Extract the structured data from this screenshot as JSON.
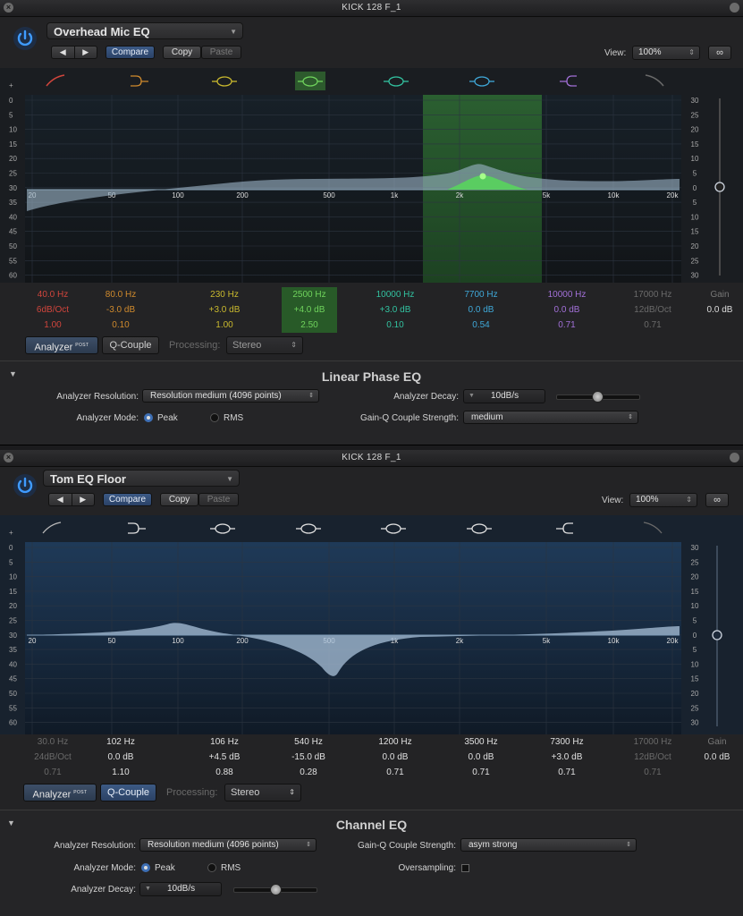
{
  "win1": {
    "title": "KICK 128 F_1",
    "preset": "Overhead Mic EQ",
    "compare": "Compare",
    "copy": "Copy",
    "paste": "Paste",
    "view_label": "View:",
    "view_value": "100%",
    "db_left": [
      "+",
      "0",
      "5",
      "10",
      "15",
      "20",
      "25",
      "30",
      "35",
      "40",
      "45",
      "50",
      "55",
      "60"
    ],
    "db_right": [
      "30",
      "25",
      "20",
      "15",
      "10",
      "5",
      "0",
      "5",
      "10",
      "15",
      "20",
      "25",
      "30"
    ],
    "freq_labels": [
      "20",
      "50",
      "100",
      "200",
      "500",
      "1k",
      "2k",
      "5k",
      "10k",
      "20k"
    ],
    "bands": [
      {
        "freq": "40.0 Hz",
        "gain": "6dB/Oct",
        "q": "1.00",
        "color": "#d0453c"
      },
      {
        "freq": "80.0 Hz",
        "gain": "-3.0 dB",
        "q": "0.10",
        "color": "#cf8a2d"
      },
      {
        "freq": "230 Hz",
        "gain": "+3.0 dB",
        "q": "1.00",
        "color": "#c9b92e"
      },
      {
        "freq": "2500 Hz",
        "gain": "+4.0 dB",
        "q": "2.50",
        "color": "#6fd35c"
      },
      {
        "freq": "10000 Hz",
        "gain": "+3.0 dB",
        "q": "0.10",
        "color": "#32c2a0"
      },
      {
        "freq": "7700 Hz",
        "gain": "0.0 dB",
        "q": "0.54",
        "color": "#3fa8d8"
      },
      {
        "freq": "10000 Hz",
        "gain": "0.0 dB",
        "q": "0.71",
        "color": "#a270d8"
      },
      {
        "freq": "17000 Hz",
        "gain": "12dB/Oct",
        "q": "0.71",
        "color": "#6a6a6a"
      }
    ],
    "gain_label": "Gain",
    "gain_value": "0.0 dB",
    "analyzer": "Analyzer",
    "post": "POST",
    "qcouple": "Q-Couple",
    "processing_label": "Processing:",
    "processing_value": "Stereo",
    "section": {
      "title": "Linear Phase EQ",
      "res_label": "Analyzer Resolution:",
      "res_value": "Resolution medium (4096 points)",
      "decay_label": "Analyzer Decay:",
      "decay_value": "10dB/s",
      "mode_label": "Analyzer Mode:",
      "mode_peak": "Peak",
      "mode_rms": "RMS",
      "gq_label": "Gain-Q Couple Strength:",
      "gq_value": "medium"
    }
  },
  "win2": {
    "title": "KICK 128 F_1",
    "preset": "Tom EQ Floor",
    "compare": "Compare",
    "copy": "Copy",
    "paste": "Paste",
    "view_label": "View:",
    "view_value": "100%",
    "db_left": [
      "+",
      "0",
      "5",
      "10",
      "15",
      "20",
      "25",
      "30",
      "35",
      "40",
      "45",
      "50",
      "55",
      "60"
    ],
    "db_right": [
      "30",
      "25",
      "20",
      "15",
      "10",
      "5",
      "0",
      "5",
      "10",
      "15",
      "20",
      "25",
      "30"
    ],
    "freq_labels": [
      "20",
      "50",
      "100",
      "200",
      "500",
      "1k",
      "2k",
      "5k",
      "10k",
      "20k"
    ],
    "bands": [
      {
        "freq": "30.0 Hz",
        "gain": "24dB/Oct",
        "q": "0.71",
        "active": false
      },
      {
        "freq": "102 Hz",
        "gain": "0.0 dB",
        "q": "1.10",
        "active": true
      },
      {
        "freq": "106 Hz",
        "gain": "+4.5 dB",
        "q": "0.88",
        "active": true
      },
      {
        "freq": "540 Hz",
        "gain": "-15.0 dB",
        "q": "0.28",
        "active": true
      },
      {
        "freq": "1200 Hz",
        "gain": "0.0 dB",
        "q": "0.71",
        "active": true
      },
      {
        "freq": "3500 Hz",
        "gain": "0.0 dB",
        "q": "0.71",
        "active": true
      },
      {
        "freq": "7300 Hz",
        "gain": "+3.0 dB",
        "q": "0.71",
        "active": true
      },
      {
        "freq": "17000 Hz",
        "gain": "12dB/Oct",
        "q": "0.71",
        "active": false
      }
    ],
    "gain_label": "Gain",
    "gain_value": "0.0 dB",
    "analyzer": "Analyzer",
    "post": "POST",
    "qcouple": "Q-Couple",
    "processing_label": "Processing:",
    "processing_value": "Stereo",
    "section": {
      "title": "Channel EQ",
      "res_label": "Analyzer Resolution:",
      "res_value": "Resolution medium (4096 points)",
      "gq_label": "Gain-Q Couple Strength:",
      "gq_value": "asym strong",
      "mode_label": "Analyzer Mode:",
      "mode_peak": "Peak",
      "mode_rms": "RMS",
      "over_label": "Oversampling:",
      "decay_label": "Analyzer Decay:",
      "decay_value": "10dB/s"
    }
  }
}
